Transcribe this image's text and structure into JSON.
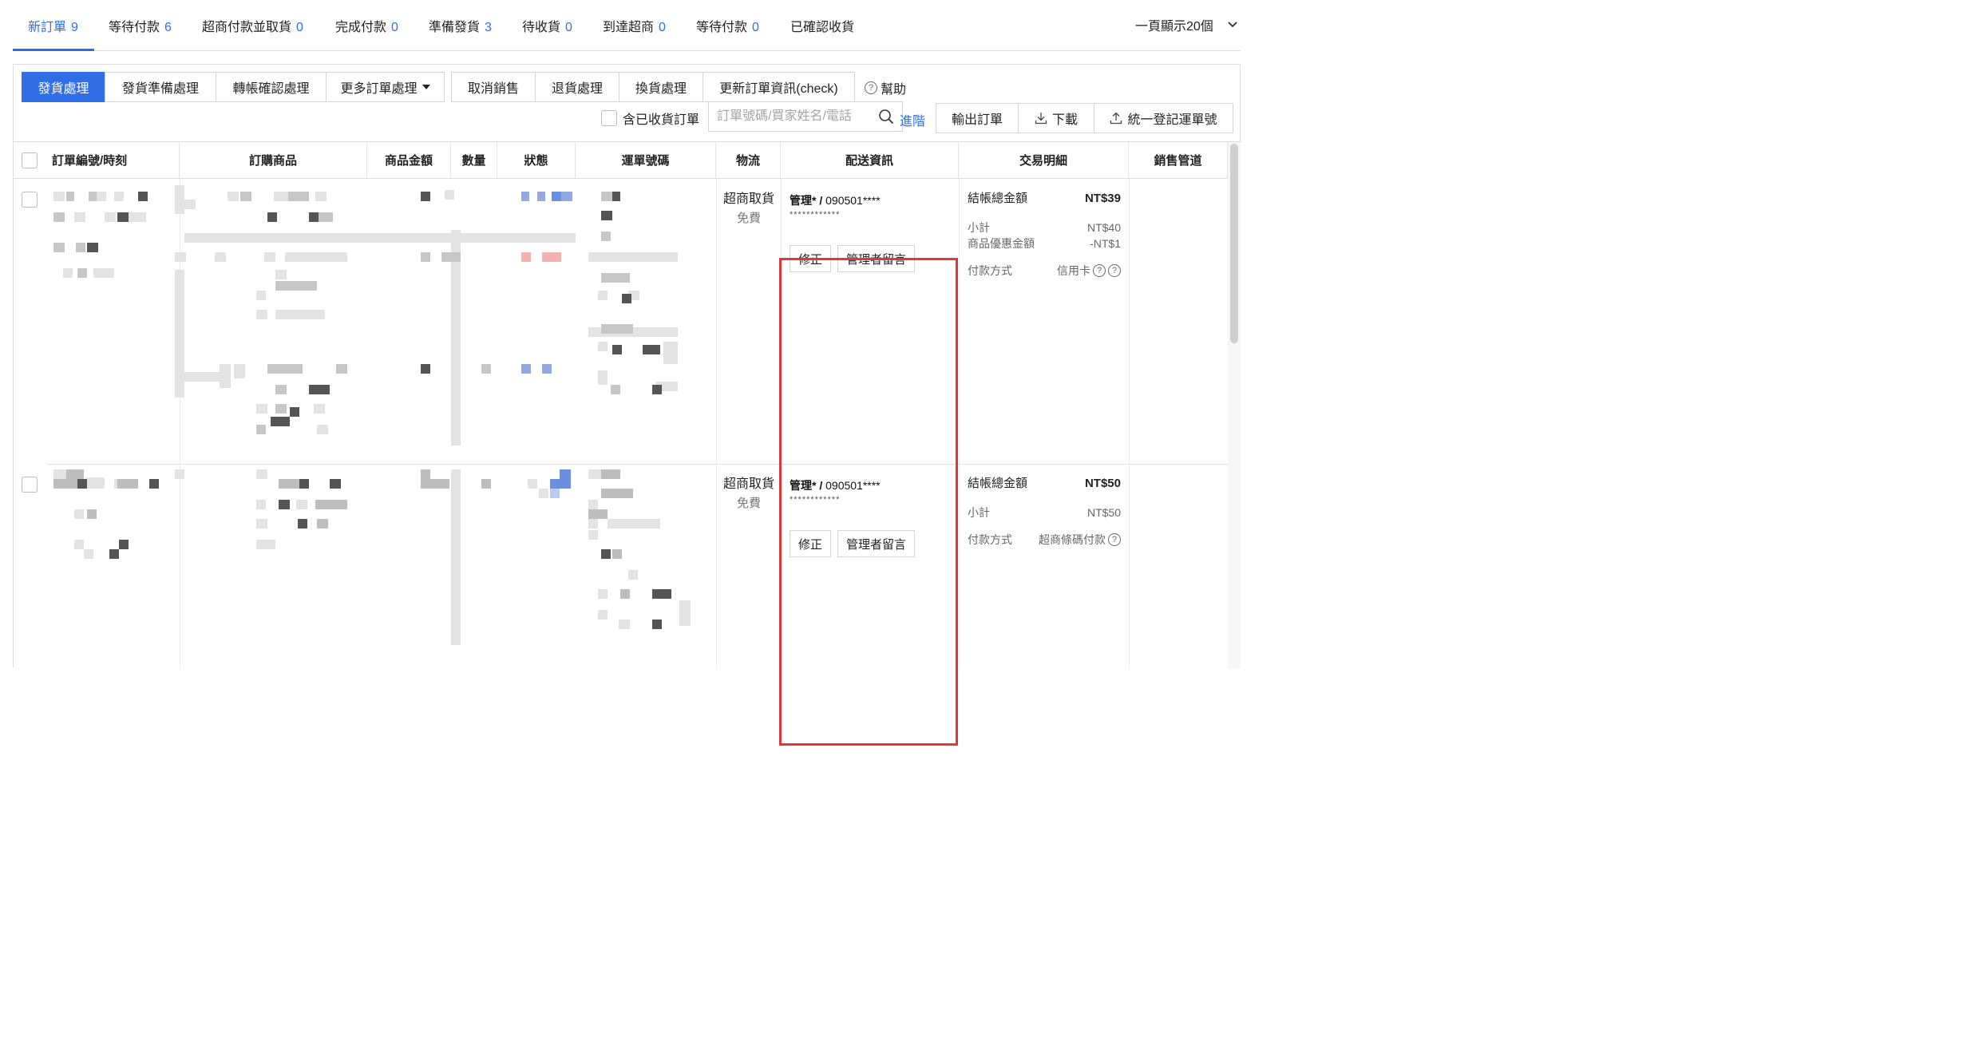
{
  "tabs": [
    {
      "label": "新訂單",
      "count": "9"
    },
    {
      "label": "等待付款",
      "count": "6"
    },
    {
      "label": "超商付款並取貨",
      "count": "0"
    },
    {
      "label": "完成付款",
      "count": "0"
    },
    {
      "label": "準備發貨",
      "count": "3"
    },
    {
      "label": "待收貨",
      "count": "0"
    },
    {
      "label": "到達超商",
      "count": "0"
    },
    {
      "label": "等待付款",
      "count": "0"
    },
    {
      "label": "已確認收貨",
      "count": ""
    }
  ],
  "per_page": "一頁顯示20個",
  "toolbar": {
    "ship": "發貨處理",
    "prepare": "發貨準備處理",
    "transfer": "轉帳確認處理",
    "more": "更多訂單處理",
    "cancel": "取消銷售",
    "return": "退貨處理",
    "exchange": "換貨處理",
    "update": "更新訂單資訊(check)",
    "help": "幫助",
    "include_received": "含已收貨訂單",
    "search_placeholder": "訂單號碼/買家姓名/電話",
    "advanced": "進階",
    "export": "輸出訂單",
    "download": "下載",
    "register": "統一登記運單號"
  },
  "columns": [
    "訂單編號/時刻",
    "訂購商品",
    "商品金額",
    "數量",
    "狀態",
    "運單號碼",
    "物流",
    "配送資訊",
    "交易明細",
    "銷售管道"
  ],
  "orders": [
    {
      "logistics": "超商取貨",
      "fee": "免費",
      "recipient": "管理*",
      "phone": "090501****",
      "address_mask": "************",
      "edit": "修正",
      "admin_msg": "管理者留言",
      "total_label": "結帳總金額",
      "total": "NT$39",
      "lines": [
        {
          "label": "小計",
          "value": "NT$40"
        },
        {
          "label": "商品優惠金額",
          "value": "-NT$1"
        }
      ],
      "payment_label": "付款方式",
      "payment": "信用卡"
    },
    {
      "logistics": "超商取貨",
      "fee": "免費",
      "recipient": "管理*",
      "phone": "090501****",
      "address_mask": "************",
      "edit": "修正",
      "admin_msg": "管理者留言",
      "total_label": "結帳總金額",
      "total": "NT$50",
      "lines": [
        {
          "label": "小計",
          "value": "NT$50"
        }
      ],
      "payment_label": "付款方式",
      "payment": "超商條碼付款"
    }
  ],
  "colors": {
    "accent": "#2f6ee6",
    "highlight": "#e0373c"
  }
}
